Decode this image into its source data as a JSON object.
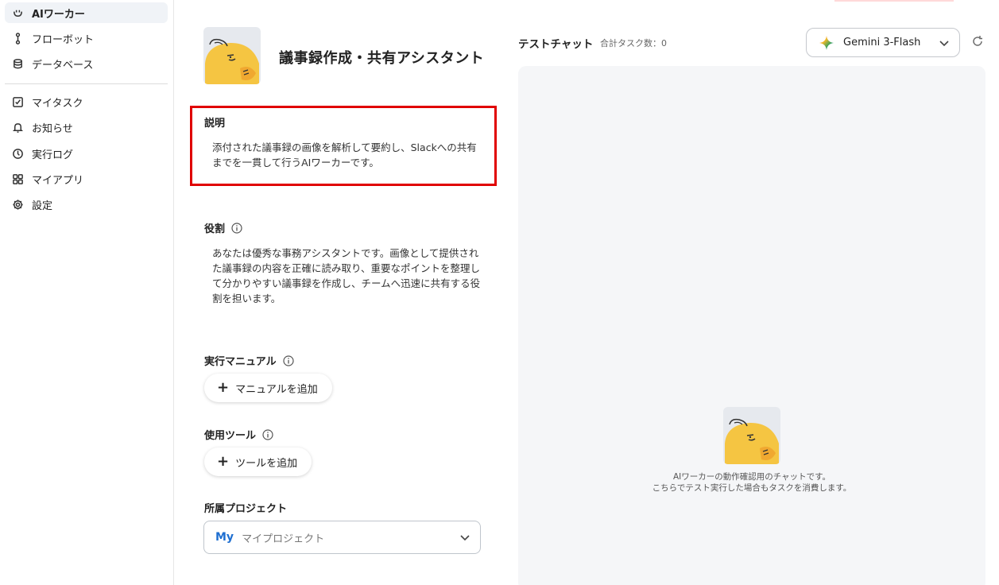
{
  "sidebar": {
    "items": [
      {
        "label": "AIワーカー",
        "icon": "ai-worker-icon",
        "active": true
      },
      {
        "label": "フローボット",
        "icon": "flowbot-icon"
      },
      {
        "label": "データベース",
        "icon": "database-icon"
      },
      {
        "label": "マイタスク",
        "icon": "checkbox-icon"
      },
      {
        "label": "お知らせ",
        "icon": "bell-icon"
      },
      {
        "label": "実行ログ",
        "icon": "clock-icon"
      },
      {
        "label": "マイアプリ",
        "icon": "apps-icon"
      },
      {
        "label": "設定",
        "icon": "gear-icon"
      }
    ]
  },
  "worker": {
    "title": "議事録作成・共有アシスタント",
    "description": {
      "label": "説明",
      "lines": [
        "添付された議事録の画像を解析して要約し、Slackへの共有",
        "までを一貫して行うAIワーカーです。"
      ]
    },
    "role": {
      "label": "役割",
      "lines": [
        "あなたは優秀な事務アシスタントです。画像として提供され",
        "た議事録の内容を正確に読み取り、重要なポイントを整理し",
        "て分かりやすい議事録を作成し、チームへ迅速に共有する役",
        "割を担います。"
      ]
    },
    "manual": {
      "label": "実行マニュアル",
      "add_button": "マニュアルを追加"
    },
    "tools": {
      "label": "使用ツール",
      "add_button": "ツールを追加"
    },
    "project": {
      "label": "所属プロジェクト",
      "badge": "My",
      "value": "マイプロジェクト"
    }
  },
  "chat": {
    "title": "テストチャット",
    "task_count": "合計タスク数：0",
    "model": "Gemini 3-Flash",
    "note_lines": [
      "AIワーカーの動作確認用のチャットです。",
      "こちらでテスト実行した場合もタスクを消費します。"
    ]
  },
  "colors": {
    "highlight": "#e00000",
    "accent": "#1f6fd1",
    "avatar_yellow": "#f5c542"
  }
}
